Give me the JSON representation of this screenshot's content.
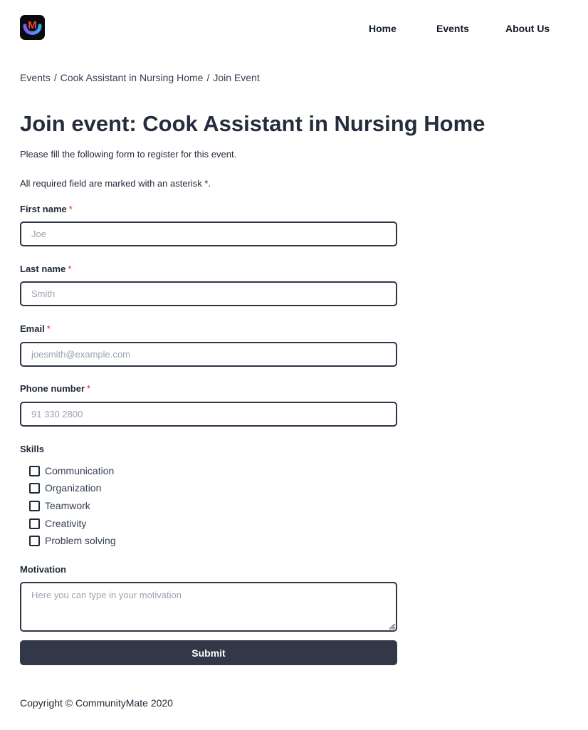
{
  "brand": {
    "logo_icon": "communitymate-logo-icon",
    "logo_letter": "M",
    "logo_colors": [
      "#f0483e",
      "#7c5cf6",
      "#3ea6f5"
    ]
  },
  "nav": {
    "items": [
      "Home",
      "Events",
      "About Us"
    ]
  },
  "breadcrumb": {
    "items": [
      "Events",
      "Cook Assistant in Nursing Home",
      "Join Event"
    ],
    "separator": "/"
  },
  "page": {
    "title": "Join event: Cook Assistant in Nursing Home",
    "intro": "Please fill the following form to register for this event.",
    "required_note": "All required field are marked with an asterisk *."
  },
  "form": {
    "required_marker": "*",
    "first_name": {
      "label": "First name",
      "placeholder": "Joe",
      "value": ""
    },
    "last_name": {
      "label": "Last name",
      "placeholder": "Smith",
      "value": ""
    },
    "email": {
      "label": "Email",
      "placeholder": "joesmith@example.com",
      "value": ""
    },
    "phone": {
      "label": "Phone number",
      "placeholder": "91 330 2800",
      "value": ""
    },
    "skills": {
      "label": "Skills",
      "options": [
        {
          "label": "Communication",
          "checked": false
        },
        {
          "label": "Organization",
          "checked": false
        },
        {
          "label": "Teamwork",
          "checked": false
        },
        {
          "label": "Creativity",
          "checked": false
        },
        {
          "label": "Problem solving",
          "checked": false
        }
      ]
    },
    "motivation": {
      "label": "Motivation",
      "placeholder": "Here you can type in your motivation",
      "value": ""
    },
    "submit_label": "Submit"
  },
  "footer": {
    "copyright": "Copyright © CommunityMate 2020"
  },
  "colors": {
    "primary_dark": "#323848",
    "required": "#dc2626",
    "input_border": "#2f3545",
    "placeholder": "#9ca3af"
  }
}
